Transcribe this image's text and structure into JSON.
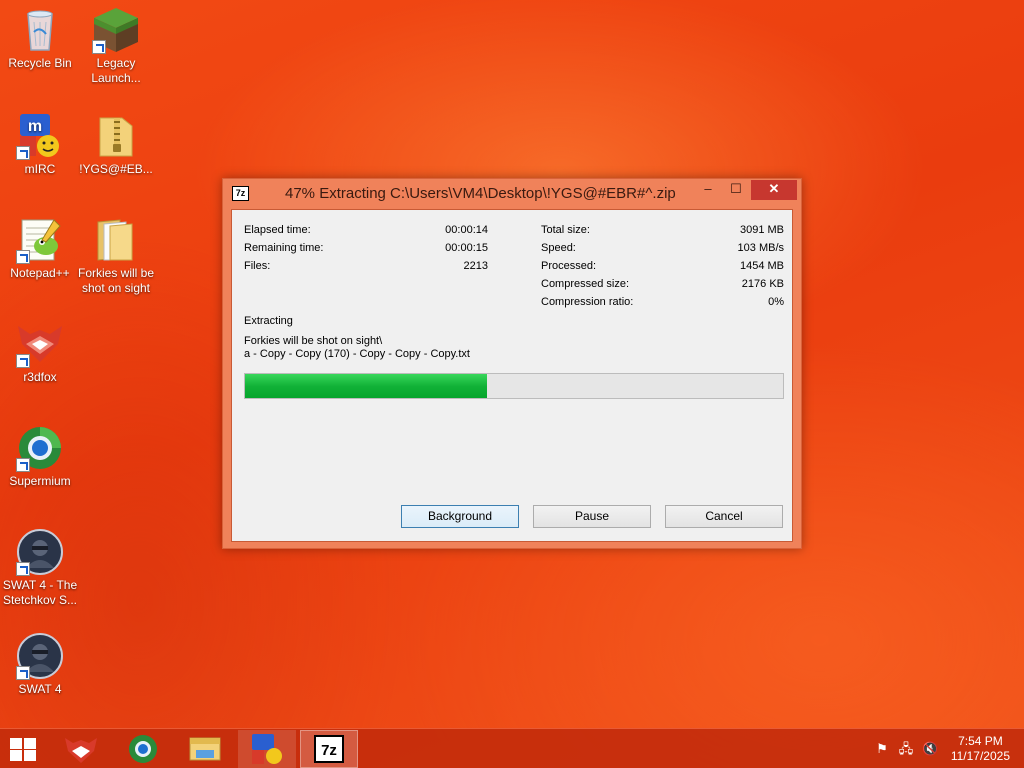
{
  "desktop": {
    "icons": [
      {
        "label": "Recycle Bin"
      },
      {
        "label": "Legacy Launch..."
      },
      {
        "label": "mIRC"
      },
      {
        "label": "!YGS@#EB..."
      },
      {
        "label": "Notepad++"
      },
      {
        "label": "Forkies will be shot on sight"
      },
      {
        "label": "r3dfox"
      },
      {
        "label": "Supermium"
      },
      {
        "label": "SWAT 4 - The Stetchkov S..."
      },
      {
        "label": "SWAT 4"
      }
    ]
  },
  "window": {
    "app_icon_text": "7z",
    "title": "47% Extracting C:\\Users\\VM4\\Desktop\\!YGS@#EBR#^.zip",
    "controls": {
      "minimize": "–",
      "maximize": "☐",
      "close": "✕"
    },
    "stats_left": [
      {
        "label": "Elapsed time:",
        "value": "00:00:14"
      },
      {
        "label": "Remaining time:",
        "value": "00:00:15"
      },
      {
        "label": "Files:",
        "value": "2213"
      }
    ],
    "stats_right": [
      {
        "label": "Total size:",
        "value": "3091 MB"
      },
      {
        "label": "Speed:",
        "value": "103 MB/s"
      },
      {
        "label": "Processed:",
        "value": "1454 MB"
      },
      {
        "label": "Compressed size:",
        "value": "2176 KB"
      },
      {
        "label": "Compression ratio:",
        "value": "0%"
      }
    ],
    "operation": "Extracting",
    "current_folder": "Forkies will be shot on sight\\",
    "current_file": "a - Copy - Copy (170) - Copy - Copy - Copy.txt",
    "progress_percent": 45,
    "progress_color": "#12b238",
    "buttons": {
      "background": "Background",
      "pause": "Pause",
      "cancel": "Cancel"
    }
  },
  "taskbar": {
    "items": [
      {
        "icon": "r3dfox-icon"
      },
      {
        "icon": "supermium-icon"
      },
      {
        "icon": "file-explorer-icon"
      },
      {
        "icon": "mirc-icon"
      },
      {
        "icon": "7zip-icon",
        "text": "7z"
      }
    ],
    "tray": {
      "flag": "⚑",
      "network": "🖧",
      "volume": "🔇"
    },
    "clock": {
      "time": "7:54 PM",
      "date": "11/17/2025"
    }
  },
  "colors": {
    "accent": "#e8401a",
    "title_bar": "#f0825a",
    "close_button": "#c7372f"
  }
}
